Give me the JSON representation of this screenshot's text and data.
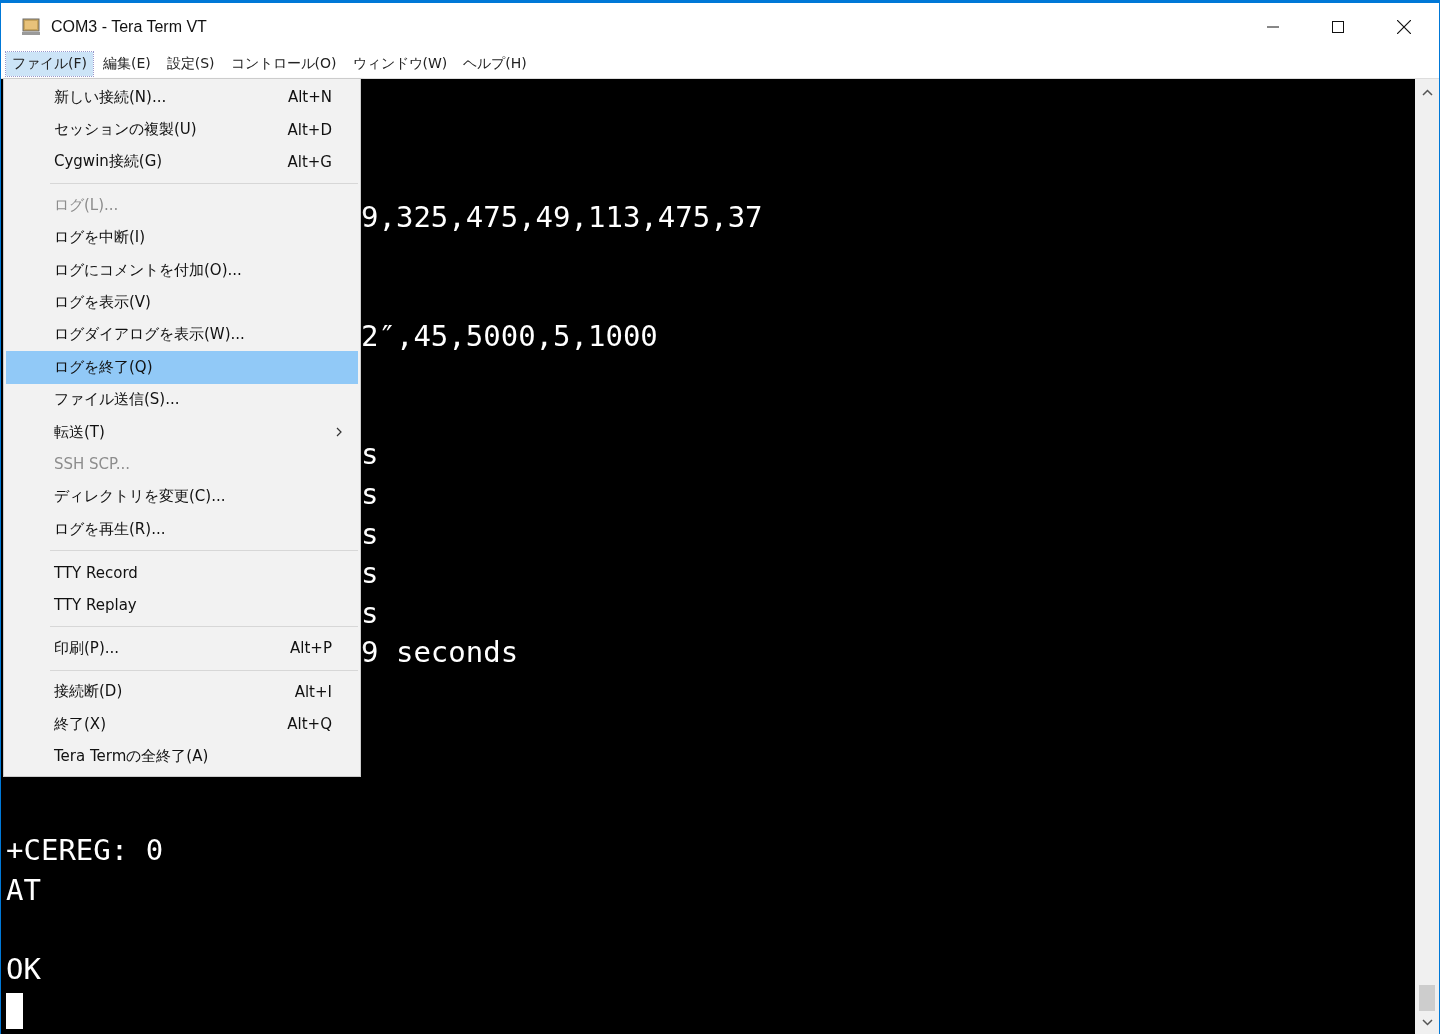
{
  "window": {
    "title": "COM3 - Tera Term VT"
  },
  "menu_bar": [
    {
      "label": "ファイル(F)",
      "selected": true
    },
    {
      "label": "編集(E)",
      "selected": false
    },
    {
      "label": "設定(S)",
      "selected": false
    },
    {
      "label": "コントロール(O)",
      "selected": false
    },
    {
      "label": "ウィンドウ(W)",
      "selected": false
    },
    {
      "label": "ヘルプ(H)",
      "selected": false
    }
  ],
  "file_menu": [
    {
      "kind": "item",
      "label": "新しい接続(N)...",
      "shortcut": "Alt+N",
      "disabled": false,
      "selected": false
    },
    {
      "kind": "item",
      "label": "セッションの複製(U)",
      "shortcut": "Alt+D",
      "disabled": false,
      "selected": false
    },
    {
      "kind": "item",
      "label": "Cygwin接続(G)",
      "shortcut": "Alt+G",
      "disabled": false,
      "selected": false
    },
    {
      "kind": "separator"
    },
    {
      "kind": "item",
      "label": "ログ(L)...",
      "disabled": true,
      "selected": false
    },
    {
      "kind": "item",
      "label": "ログを中断(I)",
      "disabled": false,
      "selected": false
    },
    {
      "kind": "item",
      "label": "ログにコメントを付加(O)...",
      "disabled": false,
      "selected": false
    },
    {
      "kind": "item",
      "label": "ログを表示(V)",
      "disabled": false,
      "selected": false
    },
    {
      "kind": "item",
      "label": "ログダイアログを表示(W)...",
      "disabled": false,
      "selected": false
    },
    {
      "kind": "item",
      "label": "ログを終了(Q)",
      "disabled": false,
      "selected": true
    },
    {
      "kind": "item",
      "label": "ファイル送信(S)...",
      "disabled": false,
      "selected": false
    },
    {
      "kind": "submenu",
      "label": "転送(T)",
      "disabled": false,
      "selected": false
    },
    {
      "kind": "item",
      "label": "SSH SCP...",
      "disabled": true,
      "selected": false
    },
    {
      "kind": "item",
      "label": "ディレクトリを変更(C)...",
      "disabled": false,
      "selected": false
    },
    {
      "kind": "item",
      "label": "ログを再生(R)...",
      "disabled": false,
      "selected": false
    },
    {
      "kind": "separator"
    },
    {
      "kind": "item",
      "label": "TTY Record",
      "disabled": false,
      "selected": false
    },
    {
      "kind": "item",
      "label": "TTY Replay",
      "disabled": false,
      "selected": false
    },
    {
      "kind": "separator"
    },
    {
      "kind": "item",
      "label": "印刷(P)...",
      "shortcut": "Alt+P",
      "disabled": false,
      "selected": false
    },
    {
      "kind": "separator"
    },
    {
      "kind": "item",
      "label": "接続断(D)",
      "shortcut": "Alt+I",
      "disabled": false,
      "selected": false
    },
    {
      "kind": "item",
      "label": "終了(X)",
      "shortcut": "Alt+Q",
      "disabled": false,
      "selected": false
    },
    {
      "kind": "item",
      "label": "Tera Termの全終了(A)",
      "disabled": false,
      "selected": false
    }
  ],
  "terminal_lines": [
    {
      "kind": "blank"
    },
    {
      "kind": "blank"
    },
    {
      "kind": "blank"
    },
    {
      "kind": "tail",
      "text": "9,325,475,49,113,475,37"
    },
    {
      "kind": "blank"
    },
    {
      "kind": "blank"
    },
    {
      "kind": "tail",
      "text": "2″,45,5000,5,1000"
    },
    {
      "kind": "blank"
    },
    {
      "kind": "blank"
    },
    {
      "kind": "tail",
      "text": "s"
    },
    {
      "kind": "tail",
      "text": "s"
    },
    {
      "kind": "tail",
      "text": "s"
    },
    {
      "kind": "tail",
      "text": "s"
    },
    {
      "kind": "tail",
      "text": "s"
    },
    {
      "kind": "tail",
      "text": "9 seconds"
    },
    {
      "kind": "blank"
    },
    {
      "kind": "blank"
    },
    {
      "kind": "blank"
    },
    {
      "kind": "blank"
    },
    {
      "kind": "full",
      "text": "+CEREG: 0"
    },
    {
      "kind": "full",
      "text": "AT"
    },
    {
      "kind": "blank"
    },
    {
      "kind": "full",
      "text": "OK"
    },
    {
      "kind": "cursor"
    }
  ]
}
